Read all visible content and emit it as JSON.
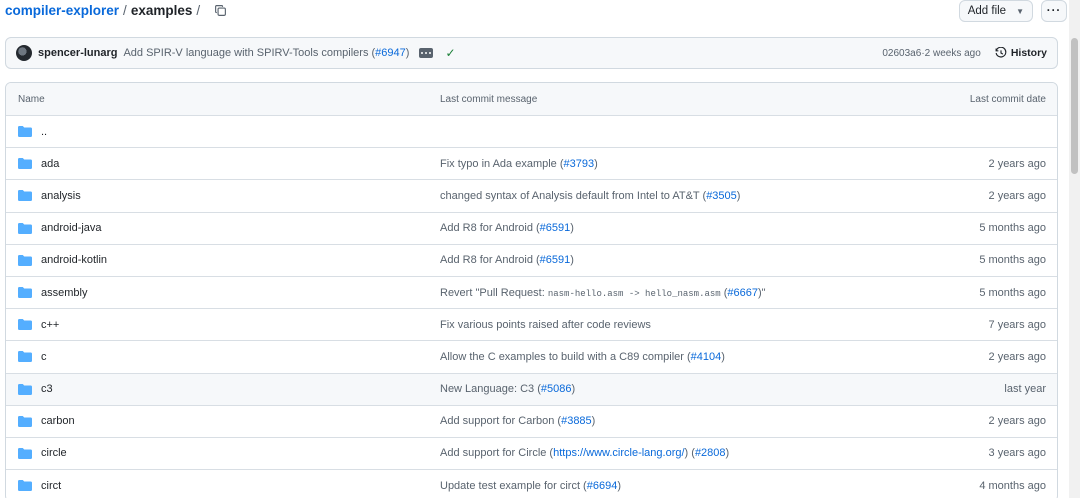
{
  "breadcrumb": {
    "repo": "compiler-explorer",
    "sep1": "/",
    "folder": "examples",
    "sep2": "/"
  },
  "actions": {
    "add_file": "Add file",
    "more": "···"
  },
  "latest_commit": {
    "author": "spencer-lunarg",
    "message": "Add SPIR-V language with SPIRV-Tools compilers (",
    "pr": "#6947",
    "message_end": ")",
    "sha": "02603a6",
    "dot": " · ",
    "time": "2 weeks ago",
    "history": "History"
  },
  "table": {
    "headers": {
      "name": "Name",
      "message": "Last commit message",
      "date": "Last commit date"
    },
    "parent": "..",
    "rows": [
      {
        "name": "ada",
        "msg": "Fix typo in Ada example (",
        "link": "#3793",
        "end": ")",
        "date": "2 years ago"
      },
      {
        "name": "analysis",
        "msg": "changed syntax of Analysis default from Intel to AT&T (",
        "link": "#3505",
        "end": ")",
        "date": "2 years ago"
      },
      {
        "name": "android-java",
        "msg": "Add R8 for Android (",
        "link": "#6591",
        "end": ")",
        "date": "5 months ago"
      },
      {
        "name": "android-kotlin",
        "msg": "Add R8 for Android (",
        "link": "#6591",
        "end": ")",
        "date": "5 months ago"
      },
      {
        "name": "assembly",
        "msg": "Revert \"Pull Request: ",
        "code": "nasm-hello.asm -> hello_nasm.asm",
        "msg2": " (",
        "link": "#6667",
        "end": ")\"",
        "date": "5 months ago"
      },
      {
        "name": "c++",
        "msg": "Fix various points raised after code reviews",
        "link": "",
        "end": "",
        "date": "7 years ago"
      },
      {
        "name": "c",
        "msg": "Allow the C examples to build with a C89 compiler (",
        "link": "#4104",
        "end": ")",
        "date": "2 years ago"
      },
      {
        "name": "c3",
        "msg": "New Language: C3 (",
        "link": "#5086",
        "end": ")",
        "date": "last year"
      },
      {
        "name": "carbon",
        "msg": "Add support for Carbon (",
        "link": "#3885",
        "end": ")",
        "date": "2 years ago"
      },
      {
        "name": "circle",
        "msg": "Add support for Circle (",
        "link": "https://www.circle-lang.org/",
        "mid": ") (",
        "link2": "#2808",
        "end": ")",
        "date": "3 years ago"
      },
      {
        "name": "circt",
        "msg": "Update test example for circt (",
        "link": "#6694",
        "end": ")",
        "date": "4 months ago"
      }
    ]
  },
  "colors": {
    "accent": "#0969da",
    "folder": "#54aeff",
    "success": "#1a7f37"
  },
  "icons": {
    "copy": "copy-icon",
    "folder": "folder-icon",
    "history": "history-icon",
    "check": "check-icon"
  }
}
